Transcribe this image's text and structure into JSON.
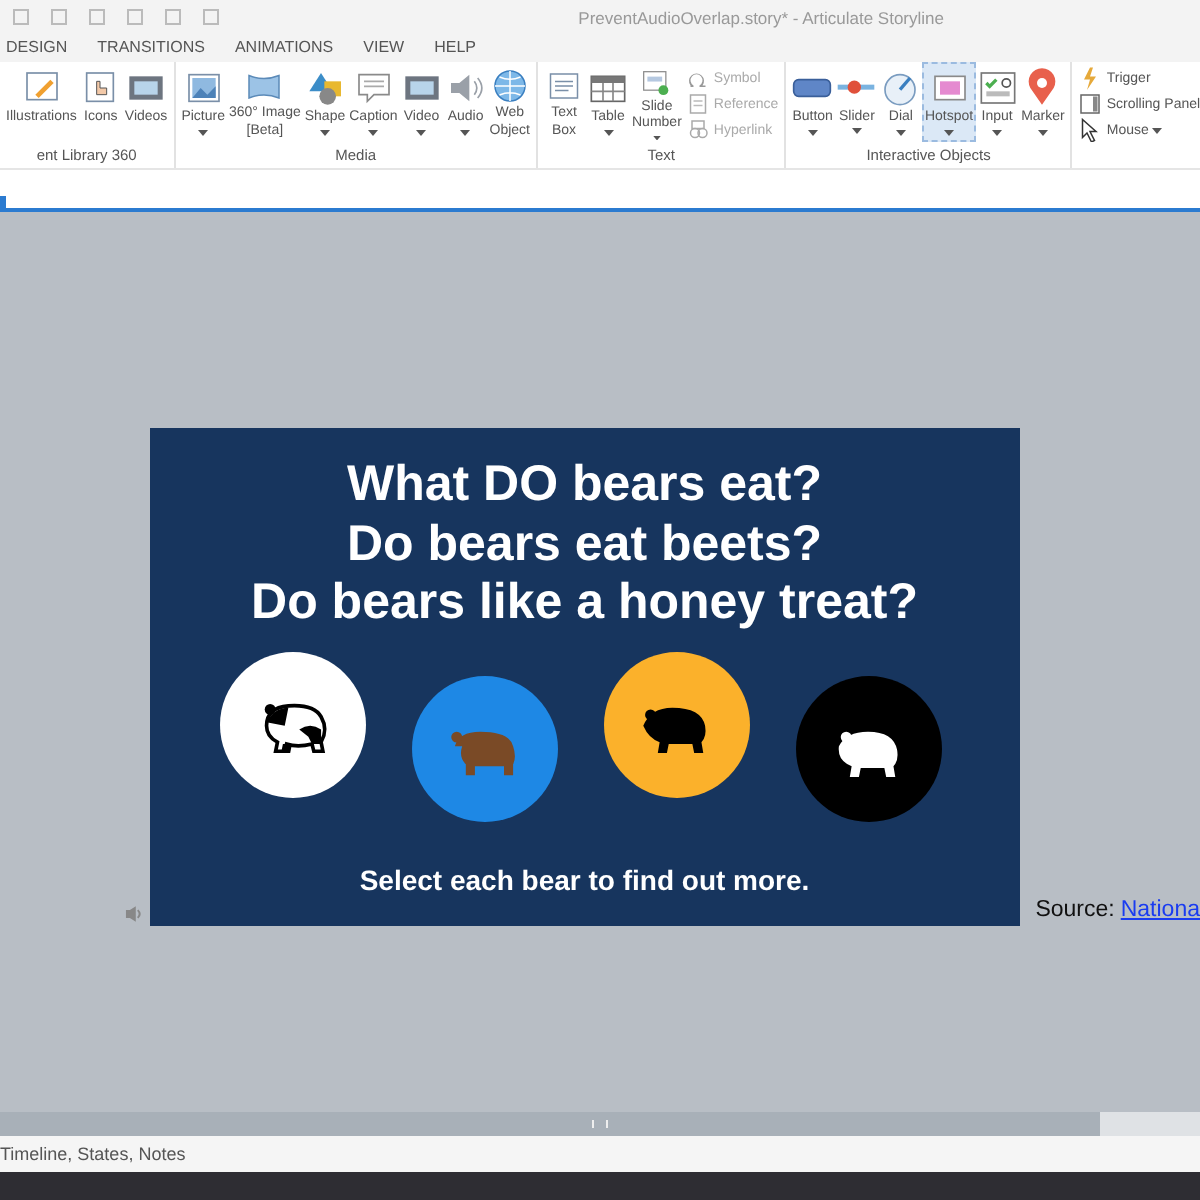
{
  "window": {
    "title": "PreventAudioOverlap.story* - Articulate Storyline"
  },
  "tabs": [
    {
      "label": "DESIGN",
      "selected": false
    },
    {
      "label": "TRANSITIONS",
      "selected": false
    },
    {
      "label": "ANIMATIONS",
      "selected": false
    },
    {
      "label": "VIEW",
      "selected": false
    },
    {
      "label": "HELP",
      "selected": false
    }
  ],
  "ribbon": {
    "groups": [
      {
        "label": "ent Library 360",
        "items": [
          {
            "kind": "large",
            "label": "Illustrations",
            "dropdown": false,
            "selected": false
          },
          {
            "kind": "large",
            "label": "Icons",
            "dropdown": false,
            "selected": false
          },
          {
            "kind": "large",
            "label": "Videos",
            "dropdown": false,
            "selected": false
          }
        ]
      },
      {
        "label": "Media",
        "items": [
          {
            "kind": "large",
            "label": "Picture",
            "dropdown": true,
            "selected": false
          },
          {
            "kind": "large",
            "label": "360° Image\n[Beta]",
            "dropdown": false,
            "selected": false
          },
          {
            "kind": "large",
            "label": "Shape",
            "dropdown": true,
            "selected": false
          },
          {
            "kind": "large",
            "label": "Caption",
            "dropdown": true,
            "selected": false
          },
          {
            "kind": "large",
            "label": "Video",
            "dropdown": true,
            "selected": false
          },
          {
            "kind": "large",
            "label": "Audio",
            "dropdown": true,
            "selected": false
          },
          {
            "kind": "large",
            "label": "Web\nObject",
            "dropdown": false,
            "selected": false
          }
        ]
      },
      {
        "label": "Text",
        "items": [
          {
            "kind": "large",
            "label": "Text\nBox",
            "dropdown": false,
            "selected": false
          },
          {
            "kind": "large",
            "label": "Table",
            "dropdown": true,
            "selected": false
          },
          {
            "kind": "large",
            "label": "Slide\nNumber",
            "dropdown": true,
            "selected": false
          },
          {
            "kind": "small",
            "label": "Symbol",
            "dropdown": false,
            "disabled": true
          },
          {
            "kind": "small",
            "label": "Reference",
            "dropdown": false,
            "disabled": true
          },
          {
            "kind": "small",
            "label": "Hyperlink",
            "dropdown": false,
            "disabled": true
          }
        ]
      },
      {
        "label": "Interactive Objects",
        "items": [
          {
            "kind": "large",
            "label": "Button",
            "dropdown": true,
            "selected": false
          },
          {
            "kind": "large",
            "label": "Slider",
            "dropdown": true,
            "selected": false
          },
          {
            "kind": "large",
            "label": "Dial",
            "dropdown": true,
            "selected": false
          },
          {
            "kind": "large",
            "label": "Hotspot",
            "dropdown": true,
            "selected": true
          },
          {
            "kind": "large",
            "label": "Input",
            "dropdown": true,
            "selected": false
          },
          {
            "kind": "large",
            "label": "Marker",
            "dropdown": true,
            "selected": false
          }
        ]
      },
      {
        "items": [
          {
            "kind": "small",
            "label": "Trigger",
            "dropdown": false,
            "disabled": false
          },
          {
            "kind": "small",
            "label": "Scrolling Panel",
            "dropdown": false,
            "disabled": false
          },
          {
            "kind": "small",
            "label": "Mouse",
            "dropdown": true,
            "disabled": false
          }
        ]
      }
    ]
  },
  "slide": {
    "title_lines": [
      "What DO bears eat?",
      "Do bears eat beets?",
      "Do bears like a honey treat?"
    ],
    "bears": [
      {
        "kind": "panda",
        "color": "#ffffff"
      },
      {
        "kind": "brown",
        "color": "#1e88e5"
      },
      {
        "kind": "black",
        "color": "#fbb12b"
      },
      {
        "kind": "polar",
        "color": "#000000"
      }
    ],
    "footer": "Select each bear to find out more."
  },
  "source": {
    "label": "Source:",
    "link": "Nationa"
  },
  "status_bar": {
    "text": "Timeline, States, Notes"
  }
}
